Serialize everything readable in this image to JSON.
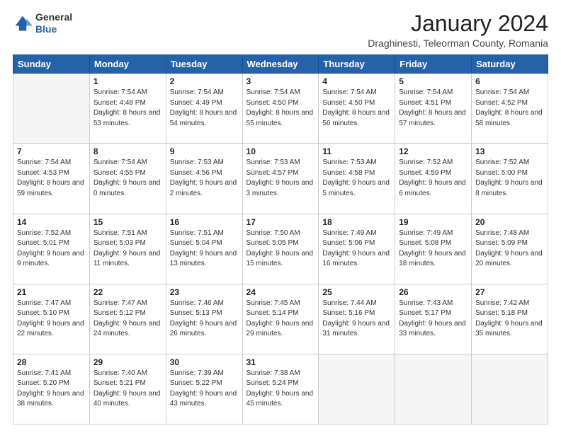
{
  "header": {
    "logo_general": "General",
    "logo_blue": "Blue",
    "month_title": "January 2024",
    "subtitle": "Draghinesti, Teleorman County, Romania"
  },
  "weekdays": [
    "Sunday",
    "Monday",
    "Tuesday",
    "Wednesday",
    "Thursday",
    "Friday",
    "Saturday"
  ],
  "weeks": [
    [
      {
        "day": "",
        "sunrise": "",
        "sunset": "",
        "daylight": ""
      },
      {
        "day": "1",
        "sunrise": "Sunrise: 7:54 AM",
        "sunset": "Sunset: 4:48 PM",
        "daylight": "Daylight: 8 hours and 53 minutes."
      },
      {
        "day": "2",
        "sunrise": "Sunrise: 7:54 AM",
        "sunset": "Sunset: 4:49 PM",
        "daylight": "Daylight: 8 hours and 54 minutes."
      },
      {
        "day": "3",
        "sunrise": "Sunrise: 7:54 AM",
        "sunset": "Sunset: 4:50 PM",
        "daylight": "Daylight: 8 hours and 55 minutes."
      },
      {
        "day": "4",
        "sunrise": "Sunrise: 7:54 AM",
        "sunset": "Sunset: 4:50 PM",
        "daylight": "Daylight: 8 hours and 56 minutes."
      },
      {
        "day": "5",
        "sunrise": "Sunrise: 7:54 AM",
        "sunset": "Sunset: 4:51 PM",
        "daylight": "Daylight: 8 hours and 57 minutes."
      },
      {
        "day": "6",
        "sunrise": "Sunrise: 7:54 AM",
        "sunset": "Sunset: 4:52 PM",
        "daylight": "Daylight: 8 hours and 58 minutes."
      }
    ],
    [
      {
        "day": "7",
        "sunrise": "Sunrise: 7:54 AM",
        "sunset": "Sunset: 4:53 PM",
        "daylight": "Daylight: 8 hours and 59 minutes."
      },
      {
        "day": "8",
        "sunrise": "Sunrise: 7:54 AM",
        "sunset": "Sunset: 4:55 PM",
        "daylight": "Daylight: 9 hours and 0 minutes."
      },
      {
        "day": "9",
        "sunrise": "Sunrise: 7:53 AM",
        "sunset": "Sunset: 4:56 PM",
        "daylight": "Daylight: 9 hours and 2 minutes."
      },
      {
        "day": "10",
        "sunrise": "Sunrise: 7:53 AM",
        "sunset": "Sunset: 4:57 PM",
        "daylight": "Daylight: 9 hours and 3 minutes."
      },
      {
        "day": "11",
        "sunrise": "Sunrise: 7:53 AM",
        "sunset": "Sunset: 4:58 PM",
        "daylight": "Daylight: 9 hours and 5 minutes."
      },
      {
        "day": "12",
        "sunrise": "Sunrise: 7:52 AM",
        "sunset": "Sunset: 4:59 PM",
        "daylight": "Daylight: 9 hours and 6 minutes."
      },
      {
        "day": "13",
        "sunrise": "Sunrise: 7:52 AM",
        "sunset": "Sunset: 5:00 PM",
        "daylight": "Daylight: 9 hours and 8 minutes."
      }
    ],
    [
      {
        "day": "14",
        "sunrise": "Sunrise: 7:52 AM",
        "sunset": "Sunset: 5:01 PM",
        "daylight": "Daylight: 9 hours and 9 minutes."
      },
      {
        "day": "15",
        "sunrise": "Sunrise: 7:51 AM",
        "sunset": "Sunset: 5:03 PM",
        "daylight": "Daylight: 9 hours and 11 minutes."
      },
      {
        "day": "16",
        "sunrise": "Sunrise: 7:51 AM",
        "sunset": "Sunset: 5:04 PM",
        "daylight": "Daylight: 9 hours and 13 minutes."
      },
      {
        "day": "17",
        "sunrise": "Sunrise: 7:50 AM",
        "sunset": "Sunset: 5:05 PM",
        "daylight": "Daylight: 9 hours and 15 minutes."
      },
      {
        "day": "18",
        "sunrise": "Sunrise: 7:49 AM",
        "sunset": "Sunset: 5:06 PM",
        "daylight": "Daylight: 9 hours and 16 minutes."
      },
      {
        "day": "19",
        "sunrise": "Sunrise: 7:49 AM",
        "sunset": "Sunset: 5:08 PM",
        "daylight": "Daylight: 9 hours and 18 minutes."
      },
      {
        "day": "20",
        "sunrise": "Sunrise: 7:48 AM",
        "sunset": "Sunset: 5:09 PM",
        "daylight": "Daylight: 9 hours and 20 minutes."
      }
    ],
    [
      {
        "day": "21",
        "sunrise": "Sunrise: 7:47 AM",
        "sunset": "Sunset: 5:10 PM",
        "daylight": "Daylight: 9 hours and 22 minutes."
      },
      {
        "day": "22",
        "sunrise": "Sunrise: 7:47 AM",
        "sunset": "Sunset: 5:12 PM",
        "daylight": "Daylight: 9 hours and 24 minutes."
      },
      {
        "day": "23",
        "sunrise": "Sunrise: 7:46 AM",
        "sunset": "Sunset: 5:13 PM",
        "daylight": "Daylight: 9 hours and 26 minutes."
      },
      {
        "day": "24",
        "sunrise": "Sunrise: 7:45 AM",
        "sunset": "Sunset: 5:14 PM",
        "daylight": "Daylight: 9 hours and 29 minutes."
      },
      {
        "day": "25",
        "sunrise": "Sunrise: 7:44 AM",
        "sunset": "Sunset: 5:16 PM",
        "daylight": "Daylight: 9 hours and 31 minutes."
      },
      {
        "day": "26",
        "sunrise": "Sunrise: 7:43 AM",
        "sunset": "Sunset: 5:17 PM",
        "daylight": "Daylight: 9 hours and 33 minutes."
      },
      {
        "day": "27",
        "sunrise": "Sunrise: 7:42 AM",
        "sunset": "Sunset: 5:18 PM",
        "daylight": "Daylight: 9 hours and 35 minutes."
      }
    ],
    [
      {
        "day": "28",
        "sunrise": "Sunrise: 7:41 AM",
        "sunset": "Sunset: 5:20 PM",
        "daylight": "Daylight: 9 hours and 38 minutes."
      },
      {
        "day": "29",
        "sunrise": "Sunrise: 7:40 AM",
        "sunset": "Sunset: 5:21 PM",
        "daylight": "Daylight: 9 hours and 40 minutes."
      },
      {
        "day": "30",
        "sunrise": "Sunrise: 7:39 AM",
        "sunset": "Sunset: 5:22 PM",
        "daylight": "Daylight: 9 hours and 43 minutes."
      },
      {
        "day": "31",
        "sunrise": "Sunrise: 7:38 AM",
        "sunset": "Sunset: 5:24 PM",
        "daylight": "Daylight: 9 hours and 45 minutes."
      },
      {
        "day": "",
        "sunrise": "",
        "sunset": "",
        "daylight": ""
      },
      {
        "day": "",
        "sunrise": "",
        "sunset": "",
        "daylight": ""
      },
      {
        "day": "",
        "sunrise": "",
        "sunset": "",
        "daylight": ""
      }
    ]
  ]
}
